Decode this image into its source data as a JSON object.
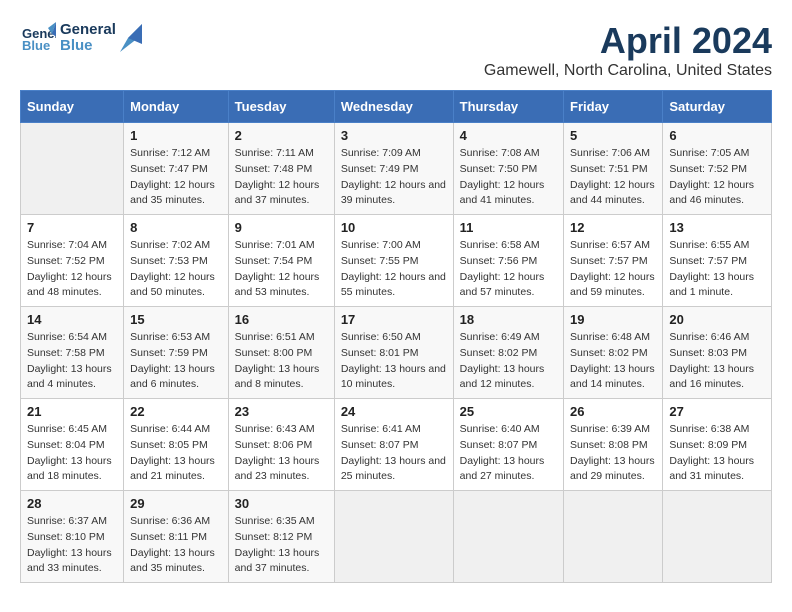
{
  "header": {
    "logo_line1": "General",
    "logo_line2": "Blue",
    "title": "April 2024",
    "subtitle": "Gamewell, North Carolina, United States"
  },
  "weekdays": [
    "Sunday",
    "Monday",
    "Tuesday",
    "Wednesday",
    "Thursday",
    "Friday",
    "Saturday"
  ],
  "weeks": [
    [
      {
        "day": "",
        "sunrise": "",
        "sunset": "",
        "daylight": ""
      },
      {
        "day": "1",
        "sunrise": "Sunrise: 7:12 AM",
        "sunset": "Sunset: 7:47 PM",
        "daylight": "Daylight: 12 hours and 35 minutes."
      },
      {
        "day": "2",
        "sunrise": "Sunrise: 7:11 AM",
        "sunset": "Sunset: 7:48 PM",
        "daylight": "Daylight: 12 hours and 37 minutes."
      },
      {
        "day": "3",
        "sunrise": "Sunrise: 7:09 AM",
        "sunset": "Sunset: 7:49 PM",
        "daylight": "Daylight: 12 hours and 39 minutes."
      },
      {
        "day": "4",
        "sunrise": "Sunrise: 7:08 AM",
        "sunset": "Sunset: 7:50 PM",
        "daylight": "Daylight: 12 hours and 41 minutes."
      },
      {
        "day": "5",
        "sunrise": "Sunrise: 7:06 AM",
        "sunset": "Sunset: 7:51 PM",
        "daylight": "Daylight: 12 hours and 44 minutes."
      },
      {
        "day": "6",
        "sunrise": "Sunrise: 7:05 AM",
        "sunset": "Sunset: 7:52 PM",
        "daylight": "Daylight: 12 hours and 46 minutes."
      }
    ],
    [
      {
        "day": "7",
        "sunrise": "Sunrise: 7:04 AM",
        "sunset": "Sunset: 7:52 PM",
        "daylight": "Daylight: 12 hours and 48 minutes."
      },
      {
        "day": "8",
        "sunrise": "Sunrise: 7:02 AM",
        "sunset": "Sunset: 7:53 PM",
        "daylight": "Daylight: 12 hours and 50 minutes."
      },
      {
        "day": "9",
        "sunrise": "Sunrise: 7:01 AM",
        "sunset": "Sunset: 7:54 PM",
        "daylight": "Daylight: 12 hours and 53 minutes."
      },
      {
        "day": "10",
        "sunrise": "Sunrise: 7:00 AM",
        "sunset": "Sunset: 7:55 PM",
        "daylight": "Daylight: 12 hours and 55 minutes."
      },
      {
        "day": "11",
        "sunrise": "Sunrise: 6:58 AM",
        "sunset": "Sunset: 7:56 PM",
        "daylight": "Daylight: 12 hours and 57 minutes."
      },
      {
        "day": "12",
        "sunrise": "Sunrise: 6:57 AM",
        "sunset": "Sunset: 7:57 PM",
        "daylight": "Daylight: 12 hours and 59 minutes."
      },
      {
        "day": "13",
        "sunrise": "Sunrise: 6:55 AM",
        "sunset": "Sunset: 7:57 PM",
        "daylight": "Daylight: 13 hours and 1 minute."
      }
    ],
    [
      {
        "day": "14",
        "sunrise": "Sunrise: 6:54 AM",
        "sunset": "Sunset: 7:58 PM",
        "daylight": "Daylight: 13 hours and 4 minutes."
      },
      {
        "day": "15",
        "sunrise": "Sunrise: 6:53 AM",
        "sunset": "Sunset: 7:59 PM",
        "daylight": "Daylight: 13 hours and 6 minutes."
      },
      {
        "day": "16",
        "sunrise": "Sunrise: 6:51 AM",
        "sunset": "Sunset: 8:00 PM",
        "daylight": "Daylight: 13 hours and 8 minutes."
      },
      {
        "day": "17",
        "sunrise": "Sunrise: 6:50 AM",
        "sunset": "Sunset: 8:01 PM",
        "daylight": "Daylight: 13 hours and 10 minutes."
      },
      {
        "day": "18",
        "sunrise": "Sunrise: 6:49 AM",
        "sunset": "Sunset: 8:02 PM",
        "daylight": "Daylight: 13 hours and 12 minutes."
      },
      {
        "day": "19",
        "sunrise": "Sunrise: 6:48 AM",
        "sunset": "Sunset: 8:02 PM",
        "daylight": "Daylight: 13 hours and 14 minutes."
      },
      {
        "day": "20",
        "sunrise": "Sunrise: 6:46 AM",
        "sunset": "Sunset: 8:03 PM",
        "daylight": "Daylight: 13 hours and 16 minutes."
      }
    ],
    [
      {
        "day": "21",
        "sunrise": "Sunrise: 6:45 AM",
        "sunset": "Sunset: 8:04 PM",
        "daylight": "Daylight: 13 hours and 18 minutes."
      },
      {
        "day": "22",
        "sunrise": "Sunrise: 6:44 AM",
        "sunset": "Sunset: 8:05 PM",
        "daylight": "Daylight: 13 hours and 21 minutes."
      },
      {
        "day": "23",
        "sunrise": "Sunrise: 6:43 AM",
        "sunset": "Sunset: 8:06 PM",
        "daylight": "Daylight: 13 hours and 23 minutes."
      },
      {
        "day": "24",
        "sunrise": "Sunrise: 6:41 AM",
        "sunset": "Sunset: 8:07 PM",
        "daylight": "Daylight: 13 hours and 25 minutes."
      },
      {
        "day": "25",
        "sunrise": "Sunrise: 6:40 AM",
        "sunset": "Sunset: 8:07 PM",
        "daylight": "Daylight: 13 hours and 27 minutes."
      },
      {
        "day": "26",
        "sunrise": "Sunrise: 6:39 AM",
        "sunset": "Sunset: 8:08 PM",
        "daylight": "Daylight: 13 hours and 29 minutes."
      },
      {
        "day": "27",
        "sunrise": "Sunrise: 6:38 AM",
        "sunset": "Sunset: 8:09 PM",
        "daylight": "Daylight: 13 hours and 31 minutes."
      }
    ],
    [
      {
        "day": "28",
        "sunrise": "Sunrise: 6:37 AM",
        "sunset": "Sunset: 8:10 PM",
        "daylight": "Daylight: 13 hours and 33 minutes."
      },
      {
        "day": "29",
        "sunrise": "Sunrise: 6:36 AM",
        "sunset": "Sunset: 8:11 PM",
        "daylight": "Daylight: 13 hours and 35 minutes."
      },
      {
        "day": "30",
        "sunrise": "Sunrise: 6:35 AM",
        "sunset": "Sunset: 8:12 PM",
        "daylight": "Daylight: 13 hours and 37 minutes."
      },
      {
        "day": "",
        "sunrise": "",
        "sunset": "",
        "daylight": ""
      },
      {
        "day": "",
        "sunrise": "",
        "sunset": "",
        "daylight": ""
      },
      {
        "day": "",
        "sunrise": "",
        "sunset": "",
        "daylight": ""
      },
      {
        "day": "",
        "sunrise": "",
        "sunset": "",
        "daylight": ""
      }
    ]
  ]
}
